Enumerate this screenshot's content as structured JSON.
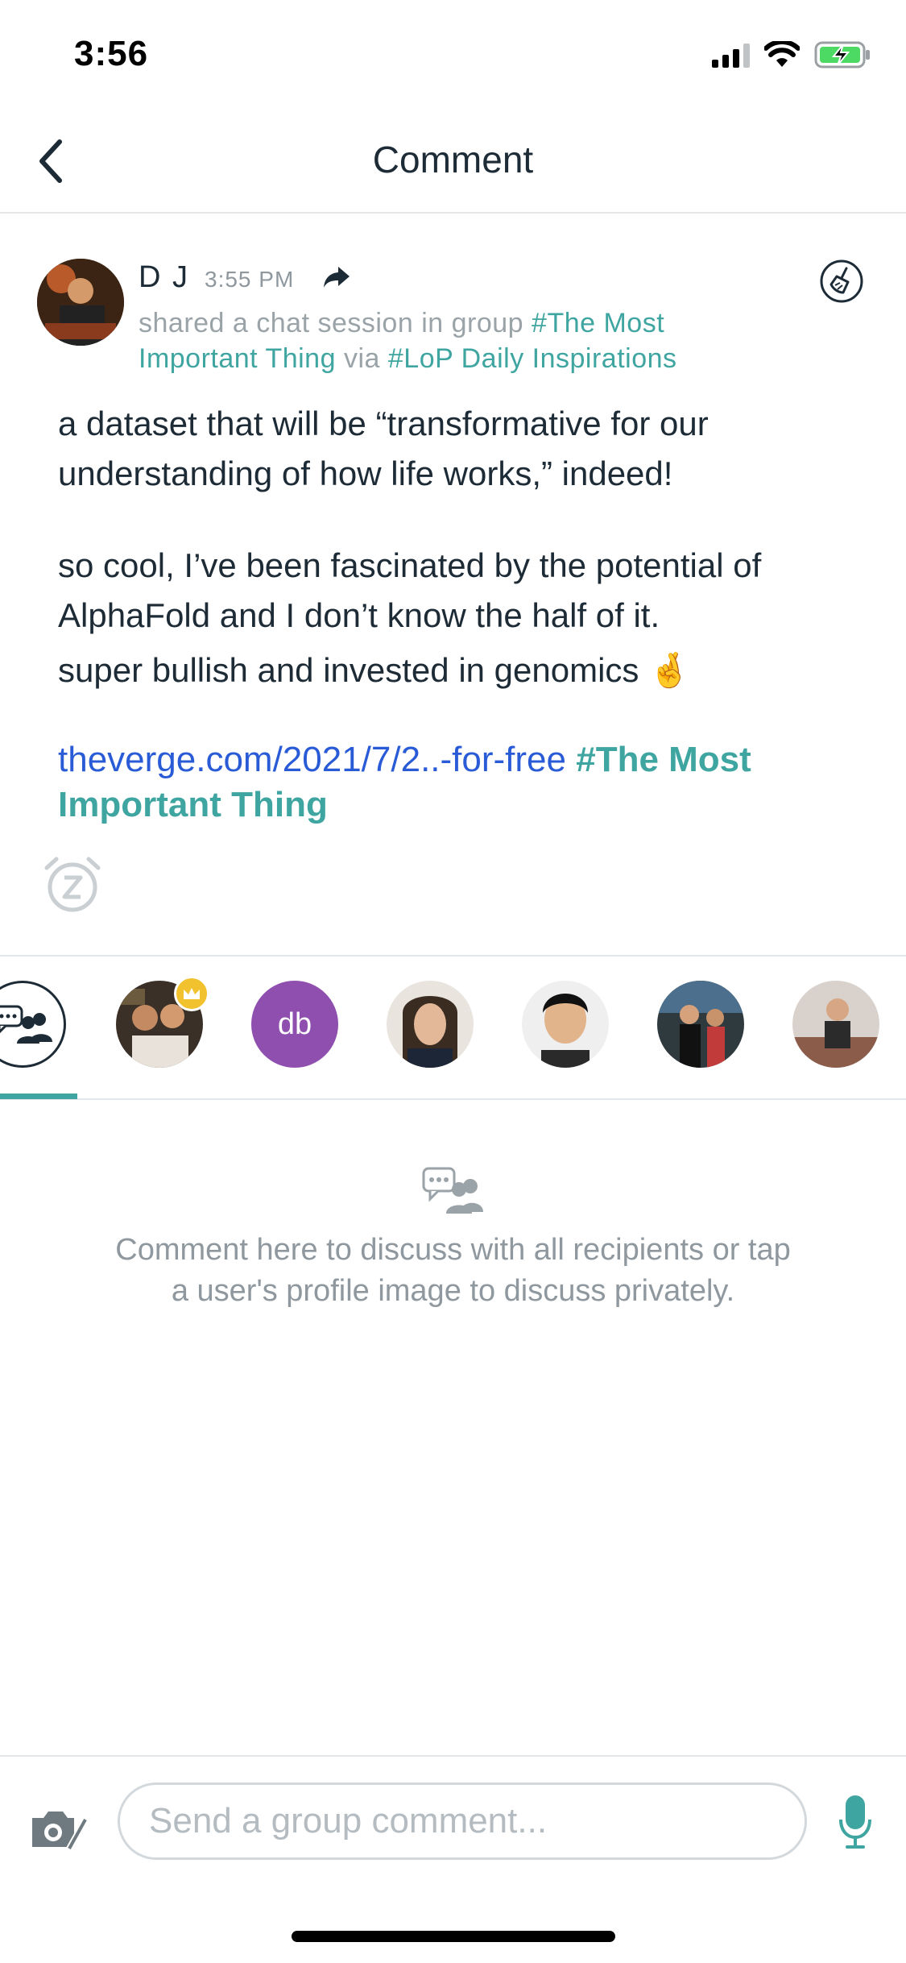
{
  "status_bar": {
    "time": "3:56"
  },
  "header": {
    "title": "Comment"
  },
  "post": {
    "author": "D J",
    "time": "3:55 PM",
    "shared_prefix": "shared a chat session in group",
    "group_tag": "#The Most Important Thing",
    "via_word": "via",
    "source_tag": "#LoP Daily Inspirations",
    "body_para1": "a dataset that will be “transformative for our understanding of how life works,” indeed!",
    "body_para2_line1": "so cool, I’ve been fascinated by the potential of AlphaFold and I don’t know the half of it.",
    "body_para2_line2": "super bullish and invested in genomics 🤞",
    "link_url": "theverge.com/2021/7/2..-for-free",
    "link_tag": "#The Most Important Thing"
  },
  "recipients": [
    {
      "type": "group",
      "icon": "group-chat-icon",
      "selected": true
    },
    {
      "type": "photo",
      "crown": true
    },
    {
      "type": "initials",
      "initials": "db",
      "color": "#8e4fae"
    },
    {
      "type": "photo"
    },
    {
      "type": "photo"
    },
    {
      "type": "photo"
    },
    {
      "type": "photo"
    }
  ],
  "empty_state": {
    "message": "Comment here to discuss with all recipients or tap a user's profile image to discuss privately."
  },
  "compose": {
    "placeholder": "Send a group comment..."
  },
  "colors": {
    "accent": "#3fa5a0",
    "link": "#2a5bd7",
    "text": "#1d2b36",
    "muted": "#8e989e"
  }
}
